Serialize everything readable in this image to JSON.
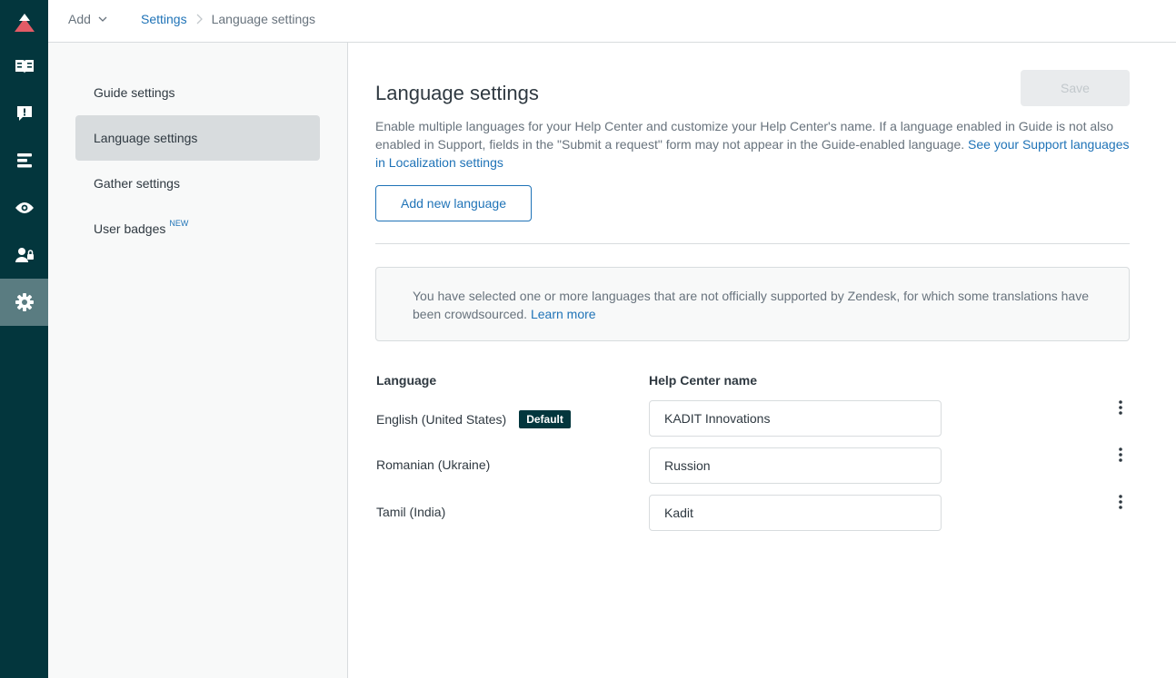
{
  "topbar": {
    "add_label": "Add",
    "breadcrumb": {
      "parent": "Settings",
      "current": "Language settings"
    }
  },
  "rail": {
    "items": [
      {
        "icon": "zendesk-guide-logo-icon"
      },
      {
        "icon": "knowledge-base-icon"
      },
      {
        "icon": "community-moderation-icon"
      },
      {
        "icon": "arrange-content-icon"
      },
      {
        "icon": "guide-preview-icon"
      },
      {
        "icon": "user-permissions-icon"
      },
      {
        "icon": "settings-gear-icon",
        "active": true
      }
    ]
  },
  "settings_nav": {
    "items": [
      {
        "label": "Guide settings"
      },
      {
        "label": "Language settings",
        "active": true
      },
      {
        "label": "Gather settings"
      },
      {
        "label": "User badges",
        "badge": "NEW"
      }
    ]
  },
  "main": {
    "title": "Language settings",
    "save_label": "Save",
    "description_text": "Enable multiple languages for your Help Center and customize your Help Center's name. If a language enabled in Guide is not also enabled in Support, fields in the \"Submit a request\" form may not appear in the Guide-enabled language. ",
    "description_link": "See your Support languages in Localization settings",
    "add_language_label": "Add new language",
    "notice_text": "You have selected one or more languages that are not officially supported by Zendesk, for which some translations have been crowdsourced. ",
    "notice_link": "Learn more",
    "columns": {
      "language": "Language",
      "hc_name": "Help Center name"
    },
    "languages": [
      {
        "name": "English (United States)",
        "badge": "Default",
        "hc_name": "KADIT Innovations"
      },
      {
        "name": "Romanian (Ukraine)",
        "hc_name": "Russion"
      },
      {
        "name": "Tamil (India)",
        "hc_name": "Kadit"
      }
    ]
  },
  "colors": {
    "rail_bg": "#03363d",
    "rail_active": "#5a7c81",
    "link": "#1f73b7",
    "logo_accent": "#e35b66"
  }
}
